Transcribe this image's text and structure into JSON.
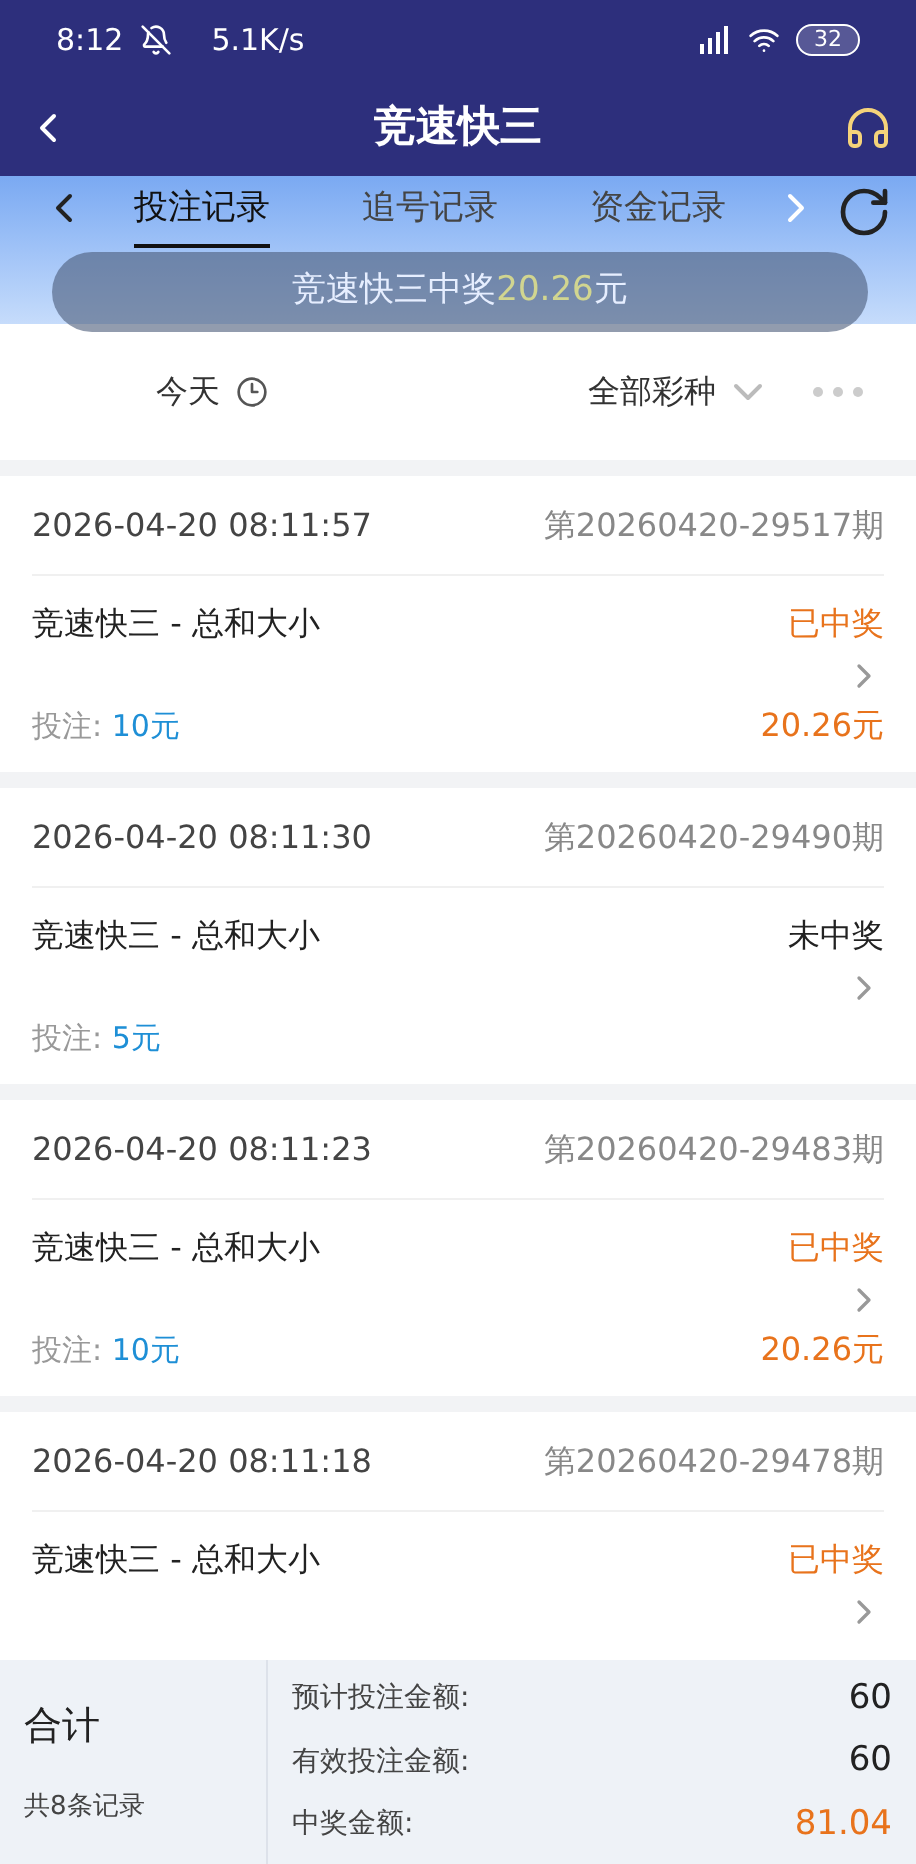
{
  "status_bar": {
    "time": "8:12",
    "speed": "5.1K/s",
    "battery": "32"
  },
  "header": {
    "title": "竞速快三"
  },
  "tabs": [
    {
      "label": "投注记录",
      "selected": true
    },
    {
      "label": "追号记录",
      "selected": false
    },
    {
      "label": "资金记录",
      "selected": false
    }
  ],
  "toast": {
    "text": "竞速快三中奖",
    "amount": "20.26",
    "unit": "元"
  },
  "filters": {
    "date": "今天",
    "lottery": "全部彩种"
  },
  "records": [
    {
      "time": "2026-04-20 08:11:57",
      "issue": "第20260420-29517期",
      "name": "竞速快三 - 总和大小",
      "won": true,
      "status": "已中奖",
      "bet_label": "投注:",
      "bet": "10元",
      "prize": "20.26元"
    },
    {
      "time": "2026-04-20 08:11:30",
      "issue": "第20260420-29490期",
      "name": "竞速快三 - 总和大小",
      "won": false,
      "status": "未中奖",
      "bet_label": "投注:",
      "bet": "5元"
    },
    {
      "time": "2026-04-20 08:11:23",
      "issue": "第20260420-29483期",
      "name": "竞速快三 - 总和大小",
      "won": true,
      "status": "已中奖",
      "bet_label": "投注:",
      "bet": "10元",
      "prize": "20.26元"
    },
    {
      "time": "2026-04-20 08:11:18",
      "issue": "第20260420-29478期",
      "name": "竞速快三 - 总和大小",
      "won": true,
      "status": "已中奖"
    }
  ],
  "summary": {
    "title": "合计",
    "count": "共8条记录",
    "rows": [
      {
        "label": "预计投注金额:",
        "value": "60",
        "kind": "plain"
      },
      {
        "label": "有效投注金额:",
        "value": "60",
        "kind": "plain"
      },
      {
        "label": "中奖金额:",
        "value": "81.04",
        "kind": "prize"
      }
    ]
  }
}
